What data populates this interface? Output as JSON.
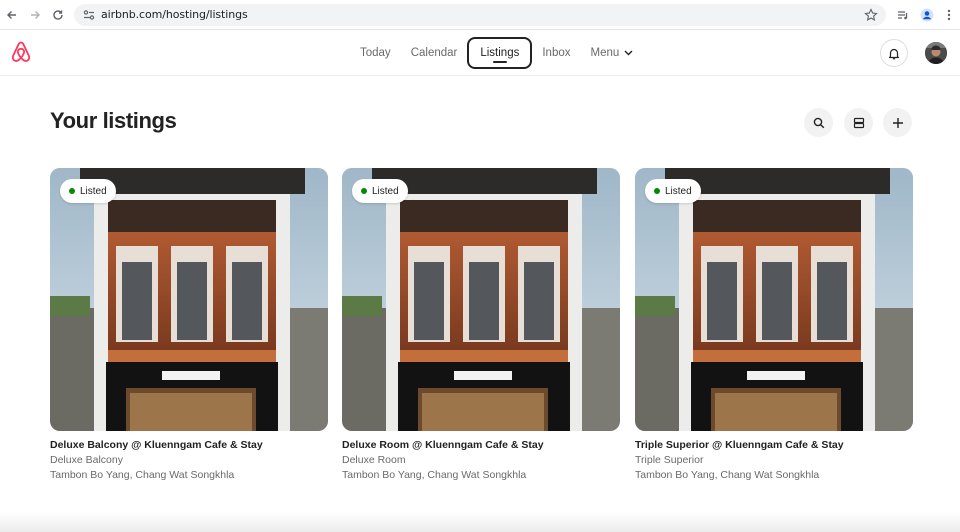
{
  "browser": {
    "url": "airbnb.com/hosting/listings"
  },
  "header": {
    "nav": [
      {
        "label": "Today"
      },
      {
        "label": "Calendar"
      },
      {
        "label": "Listings"
      },
      {
        "label": "Inbox"
      },
      {
        "label": "Menu"
      }
    ],
    "active_tab": "Listings",
    "brand_color": "#ff385c"
  },
  "page": {
    "title": "Your listings",
    "actions": [
      "search-icon",
      "list-view-icon",
      "plus-icon"
    ]
  },
  "listings": [
    {
      "status": "Listed",
      "title": "Deluxe Balcony @ Kluenngam Cafe & Stay",
      "type": "Deluxe Balcony",
      "location": "Tambon Bo Yang, Chang Wat Songkhla"
    },
    {
      "status": "Listed",
      "title": "Deluxe Room @ Kluenngam Cafe & Stay",
      "type": "Deluxe Room",
      "location": "Tambon Bo Yang, Chang Wat Songkhla"
    },
    {
      "status": "Listed",
      "title": "Triple Superior @ Kluenngam Cafe & Stay",
      "type": "Triple Superior",
      "location": "Tambon Bo Yang, Chang Wat Songkhla"
    }
  ],
  "colors": {
    "listed_dot": "#008a05",
    "text_primary": "#222222",
    "text_secondary": "#6a6a6a"
  }
}
